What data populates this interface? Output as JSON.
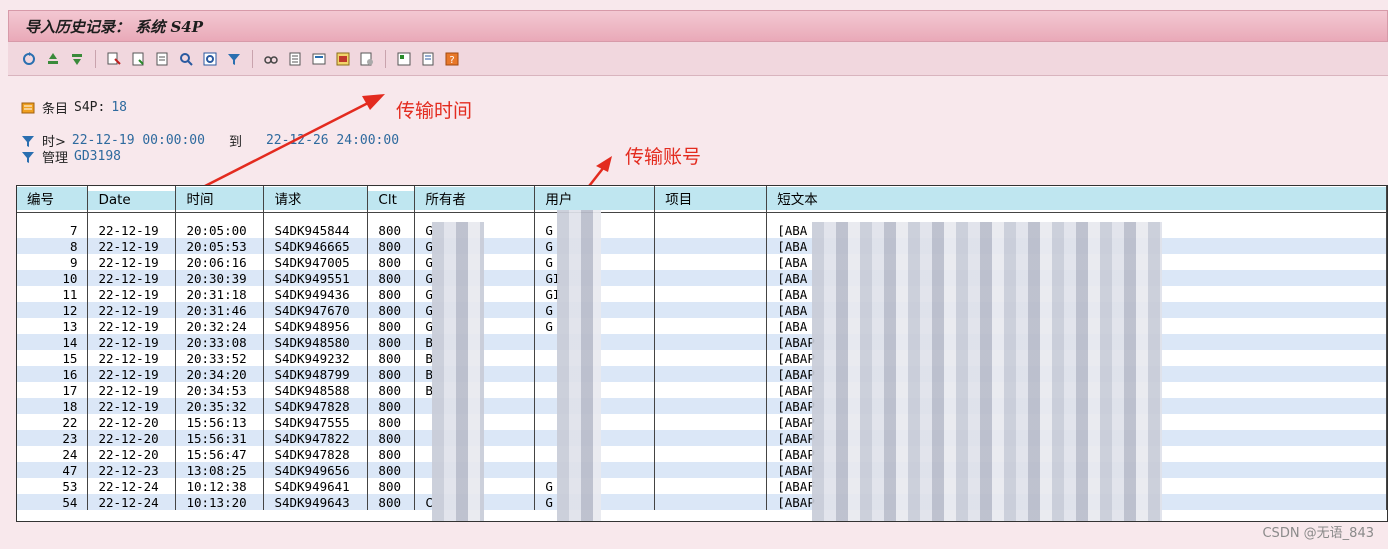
{
  "window": {
    "title": "导入历史记录： 系统 S4P"
  },
  "toolbar": {
    "icons": [
      "refresh-icon",
      "sort-asc-icon",
      "sort-desc-icon",
      "select-icon",
      "detail-icon",
      "page-icon",
      "find-icon",
      "find-next-icon",
      "filter-icon",
      "glasses-icon",
      "print-icon",
      "export-icon",
      "layout-icon",
      "change-layout-icon",
      "info-icon",
      "settings-icon",
      "help-icon"
    ]
  },
  "info": {
    "entries_label": "条目",
    "entries_system": "S4P:",
    "entries_count": "18",
    "time_label": "时>",
    "time_from": "22-12-19 00:00:00",
    "time_to_label": "到",
    "time_to": "22-12-26 24:00:00",
    "admin_label": "管理",
    "admin_value": "GD3198"
  },
  "annotations": {
    "transfer_time": "传输时间",
    "transfer_account": "传输账号"
  },
  "table": {
    "headers": [
      "编号",
      "Date",
      "时间",
      "请求",
      "Clt",
      "所有者",
      "用户",
      "项目",
      "短文本"
    ],
    "rows": [
      {
        "id": "7",
        "date": "22-12-19",
        "time": "20:05:00",
        "req": "S4DK945844",
        "clt": "800",
        "owner": "G",
        "user": "G",
        "text": "[ABA"
      },
      {
        "id": "8",
        "date": "22-12-19",
        "time": "20:05:53",
        "req": "S4DK946665",
        "clt": "800",
        "owner": "G",
        "user": "G",
        "text": "[ABA"
      },
      {
        "id": "9",
        "date": "22-12-19",
        "time": "20:06:16",
        "req": "S4DK947005",
        "clt": "800",
        "owner": "G",
        "user": "G",
        "text": "[ABA"
      },
      {
        "id": "10",
        "date": "22-12-19",
        "time": "20:30:39",
        "req": "S4DK949551",
        "clt": "800",
        "owner": "G",
        "user": "GI",
        "text": "[ABA"
      },
      {
        "id": "11",
        "date": "22-12-19",
        "time": "20:31:18",
        "req": "S4DK949436",
        "clt": "800",
        "owner": "G",
        "user": "GI",
        "text": "[ABA"
      },
      {
        "id": "12",
        "date": "22-12-19",
        "time": "20:31:46",
        "req": "S4DK947670",
        "clt": "800",
        "owner": "G",
        "user": "G",
        "text": "[ABA"
      },
      {
        "id": "13",
        "date": "22-12-19",
        "time": "20:32:24",
        "req": "S4DK948956",
        "clt": "800",
        "owner": "G",
        "user": "G",
        "text": "[ABA"
      },
      {
        "id": "14",
        "date": "22-12-19",
        "time": "20:33:08",
        "req": "S4DK948580",
        "clt": "800",
        "owner": "B",
        "user": "",
        "text": "[ABAP"
      },
      {
        "id": "15",
        "date": "22-12-19",
        "time": "20:33:52",
        "req": "S4DK949232",
        "clt": "800",
        "owner": "B",
        "user": "",
        "text": "[ABAP"
      },
      {
        "id": "16",
        "date": "22-12-19",
        "time": "20:34:20",
        "req": "S4DK948799",
        "clt": "800",
        "owner": "B",
        "user": "",
        "text": "[ABAP"
      },
      {
        "id": "17",
        "date": "22-12-19",
        "time": "20:34:53",
        "req": "S4DK948588",
        "clt": "800",
        "owner": "B",
        "user": "",
        "text": "[ABAP"
      },
      {
        "id": "18",
        "date": "22-12-19",
        "time": "20:35:32",
        "req": "S4DK947828",
        "clt": "800",
        "owner": "",
        "user": "",
        "text": "[ABAP"
      },
      {
        "id": "22",
        "date": "22-12-20",
        "time": "15:56:13",
        "req": "S4DK947555",
        "clt": "800",
        "owner": "",
        "user": "",
        "text": "[ABAP"
      },
      {
        "id": "23",
        "date": "22-12-20",
        "time": "15:56:31",
        "req": "S4DK947822",
        "clt": "800",
        "owner": "",
        "user": "",
        "text": "[ABAP"
      },
      {
        "id": "24",
        "date": "22-12-20",
        "time": "15:56:47",
        "req": "S4DK947828",
        "clt": "800",
        "owner": "",
        "user": "",
        "text": "[ABAP"
      },
      {
        "id": "47",
        "date": "22-12-23",
        "time": "13:08:25",
        "req": "S4DK949656",
        "clt": "800",
        "owner": "",
        "user": "",
        "text": "[ABAP"
      },
      {
        "id": "53",
        "date": "22-12-24",
        "time": "10:12:38",
        "req": "S4DK949641",
        "clt": "800",
        "owner": "",
        "user": "G",
        "text": "[ABAF"
      },
      {
        "id": "54",
        "date": "22-12-24",
        "time": "10:13:20",
        "req": "S4DK949643",
        "clt": "800",
        "owner": "C",
        "user": "G",
        "text": "[ABAP"
      }
    ]
  },
  "watermark": "CSDN @无语_843",
  "colors": {
    "header_cell": "#bfe6f0",
    "row_alt": "#dbe7f7",
    "annotation": "#e32b1f",
    "titlebar": "#eab5c2"
  }
}
